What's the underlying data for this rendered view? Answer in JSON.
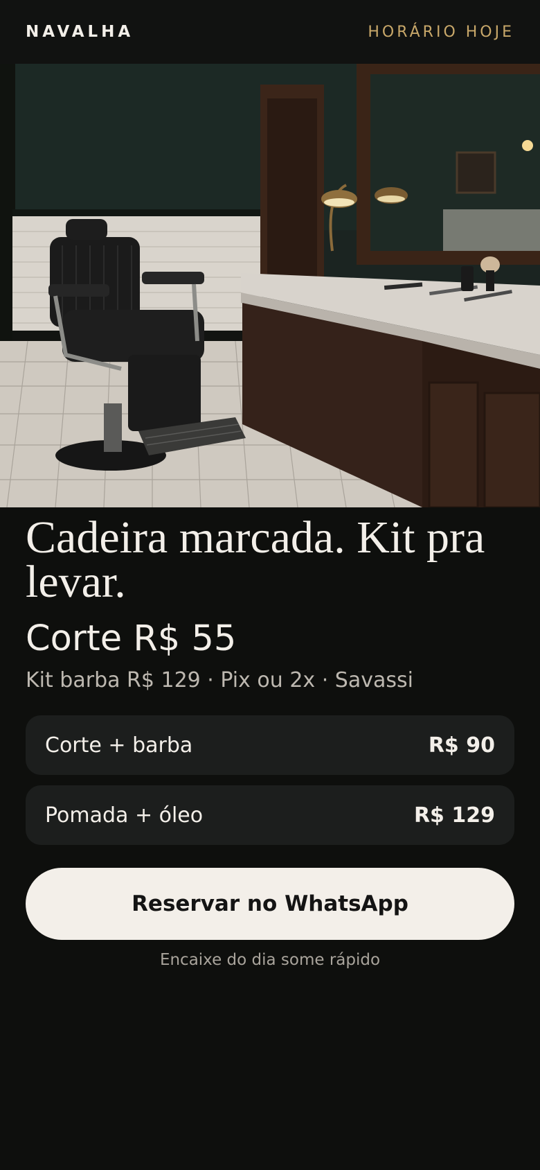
{
  "header": {
    "brand": "NAVALHA",
    "hours_link": "HORÁRIO HOJE"
  },
  "hero": {
    "image_description_icon": "barber-chair-photo"
  },
  "main": {
    "headline": "Cadeira marcada. Kit pra levar.",
    "price": "Corte R$ 55",
    "subline": "Kit barba R$ 129 · Pix ou 2x · Savassi"
  },
  "services": [
    {
      "name": "Corte + barba",
      "price": "R$ 90"
    },
    {
      "name": "Pomada + óleo",
      "price": "R$ 129"
    }
  ],
  "cta": {
    "label": "Reservar no WhatsApp",
    "note": "Encaixe do dia some rápido"
  },
  "colors": {
    "background": "#0e0f0d",
    "accent": "#c9a86a",
    "card": "#1c1e1d",
    "button": "#f3efe9"
  }
}
